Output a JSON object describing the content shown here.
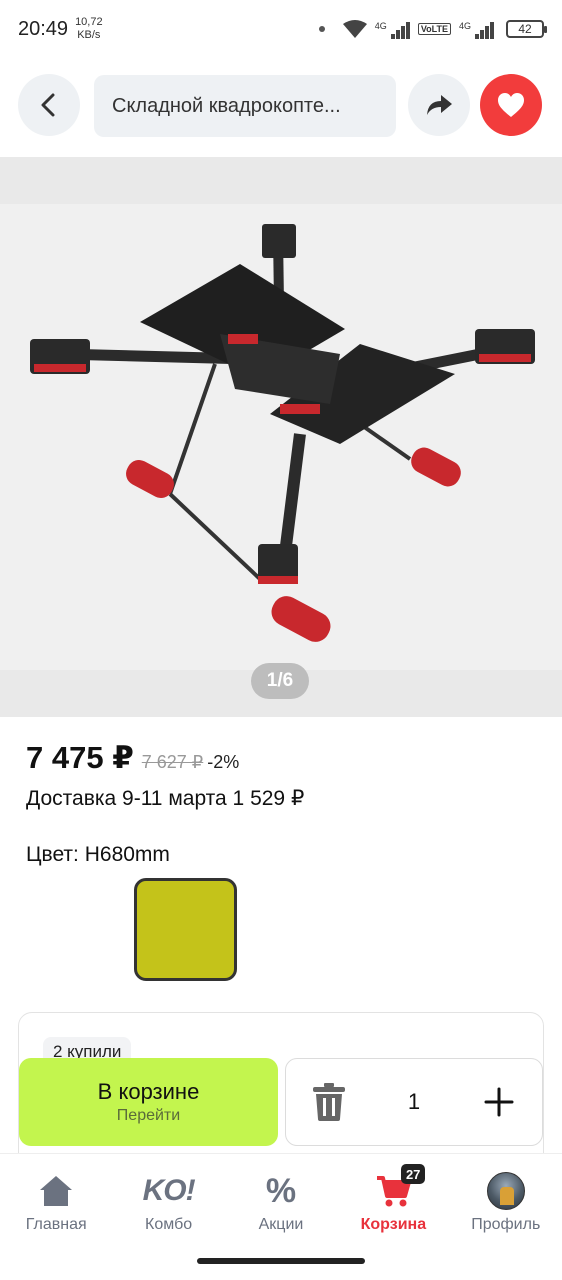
{
  "status_bar": {
    "time": "20:49",
    "speed_value": "10,72",
    "speed_unit": "KB/s",
    "net1": "4G",
    "volte": "VoLTE",
    "net2": "4G",
    "battery": "42"
  },
  "header": {
    "search_text": "Складной квадрокопте...",
    "icons": {
      "back": "chevron-left-icon",
      "share": "share-arrow-icon",
      "favorite": "heart-icon"
    },
    "favorite_color": "#f23c3c"
  },
  "gallery": {
    "page_indicator": "1/6",
    "image": "drone-photo"
  },
  "product": {
    "price": "7 475 ₽",
    "old_price": "7 627 ₽",
    "discount": "-2%",
    "delivery": "Доставка 9-11 марта 1 529 ₽",
    "color_label": "Цвет: H680mm",
    "swatch_color": "#c4c31a"
  },
  "buyers": {
    "badge": "2 купили"
  },
  "cart_action": {
    "title": "В корзине",
    "subtitle": "Перейти",
    "quantity": "1",
    "accent": "#c3f54e"
  },
  "bottom_nav": {
    "items": [
      {
        "label": "Главная",
        "icon": "home-icon"
      },
      {
        "label": "Комбо",
        "icon": "ko-icon",
        "glyph": "KO!"
      },
      {
        "label": "Акции",
        "icon": "percent-icon",
        "glyph": "%"
      },
      {
        "label": "Корзина",
        "icon": "cart-icon",
        "badge": "27",
        "active": true
      },
      {
        "label": "Профиль",
        "icon": "avatar-icon"
      }
    ],
    "active_color": "#e8323c"
  }
}
